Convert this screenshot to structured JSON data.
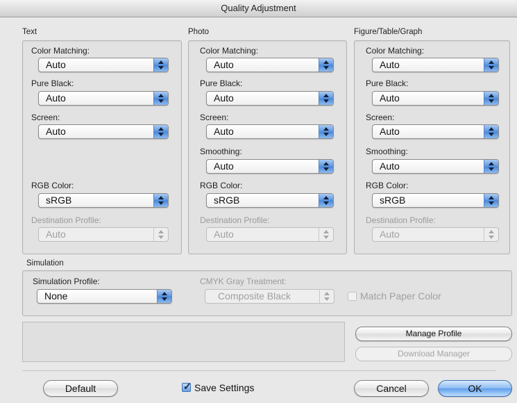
{
  "window": {
    "title": "Quality Adjustment"
  },
  "groups": {
    "text": {
      "label": "Text",
      "color_matching": {
        "label": "Color Matching:",
        "value": "Auto"
      },
      "pure_black": {
        "label": "Pure Black:",
        "value": "Auto"
      },
      "screen": {
        "label": "Screen:",
        "value": "Auto"
      },
      "rgb_color": {
        "label": "RGB Color:",
        "value": "sRGB"
      },
      "destination_profile": {
        "label": "Destination Profile:",
        "value": "Auto"
      }
    },
    "photo": {
      "label": "Photo",
      "color_matching": {
        "label": "Color Matching:",
        "value": "Auto"
      },
      "pure_black": {
        "label": "Pure Black:",
        "value": "Auto"
      },
      "screen": {
        "label": "Screen:",
        "value": "Auto"
      },
      "smoothing": {
        "label": "Smoothing:",
        "value": "Auto"
      },
      "rgb_color": {
        "label": "RGB Color:",
        "value": "sRGB"
      },
      "destination_profile": {
        "label": "Destination Profile:",
        "value": "Auto"
      }
    },
    "figure": {
      "label": "Figure/Table/Graph",
      "color_matching": {
        "label": "Color Matching:",
        "value": "Auto"
      },
      "pure_black": {
        "label": "Pure Black:",
        "value": "Auto"
      },
      "screen": {
        "label": "Screen:",
        "value": "Auto"
      },
      "smoothing": {
        "label": "Smoothing:",
        "value": "Auto"
      },
      "rgb_color": {
        "label": "RGB Color:",
        "value": "sRGB"
      },
      "destination_profile": {
        "label": "Destination Profile:",
        "value": "Auto"
      }
    }
  },
  "simulation": {
    "label": "Simulation",
    "profile": {
      "label": "Simulation Profile:",
      "value": "None"
    },
    "cmyk_gray": {
      "label": "CMYK Gray Treatment:",
      "value": "Composite Black"
    },
    "match_paper_color": {
      "label": "Match Paper Color",
      "checked": false
    }
  },
  "buttons": {
    "manage_profile": "Manage Profile",
    "download_manager": "Download Manager",
    "default": "Default",
    "cancel": "Cancel",
    "ok": "OK"
  },
  "save_settings": {
    "label": "Save Settings",
    "checked": true
  },
  "icons": {
    "popup_arrows": "up-down-arrows-icon",
    "checkmark": "checkmark-icon"
  },
  "colors": {
    "accent_blue": "#5b93de"
  }
}
